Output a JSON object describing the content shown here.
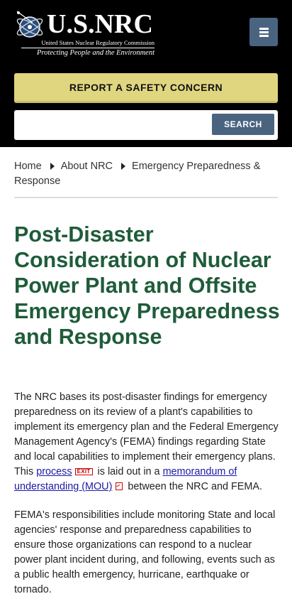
{
  "header": {
    "logo_title": "U.S.NRC",
    "logo_subtitle": "United States Nuclear Regulatory Commission",
    "logo_tagline": "Protecting People and the Environment",
    "menu_icon": "hamburger-menu-icon",
    "report_label": "REPORT A SAFETY CONCERN",
    "search": {
      "value": "",
      "placeholder": "",
      "button_label": "SEARCH"
    },
    "colors": {
      "report_button": "#e0d680",
      "search_button": "#4a6480",
      "menu_button": "#4a6480"
    }
  },
  "breadcrumb": {
    "items": [
      "Home",
      "About NRC",
      "Emergency Preparedness & Response"
    ]
  },
  "page": {
    "title": "Post-Disaster Consideration of Nuclear Power Plant and Offsite Emergency Preparedness and Response",
    "title_color": "#1f5c3a",
    "p1": {
      "text_a": "The NRC bases its post-disaster findings for emergency preparedness on its review of a plant's capabilities to implement its emergency plan and the Federal Emergency Management Agency's (FEMA) findings regarding State and local capabilities to implement their emergency plans. This ",
      "link_process": "process",
      "exit_badge": "EXIT",
      "text_b": " is laid out in a ",
      "link_mou": "memorandum of understanding (MOU)",
      "pdf_icon": "pdf-icon",
      "text_c": " between the NRC and FEMA."
    },
    "p2": "FEMA's responsibilities include monitoring State and local agencies' response and preparedness capabilities to ensure those organizations can respond to a nuclear power plant incident during, and following, events such as a public health emergency, hurricane, earthquake or tornado."
  }
}
